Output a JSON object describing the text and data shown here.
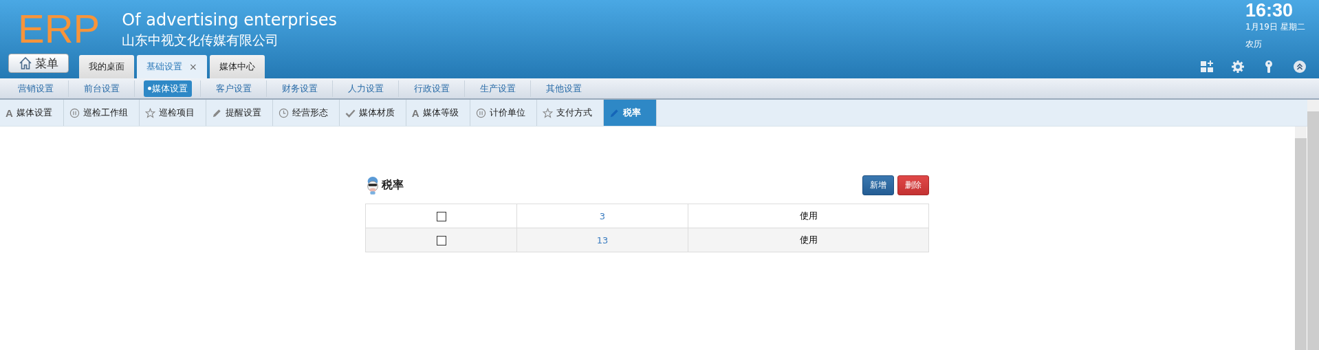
{
  "header": {
    "logo": "ERP",
    "title": "Of advertising enterprises",
    "subtitle": "山东中视文化传媒有限公司",
    "menu_button": "菜单",
    "clock": {
      "time": "16:30",
      "date": "1月19日 星期二",
      "lunar": "农历"
    }
  },
  "tabs": [
    {
      "label": "我的桌面",
      "selected": false
    },
    {
      "label": "基础设置",
      "selected": true,
      "close": "×"
    },
    {
      "label": "媒体中心",
      "selected": false
    }
  ],
  "subnav": [
    {
      "label": "营销设置",
      "selected": false
    },
    {
      "label": "前台设置",
      "selected": false
    },
    {
      "label": "媒体设置",
      "selected": true
    },
    {
      "label": "客户设置",
      "selected": false
    },
    {
      "label": "财务设置",
      "selected": false
    },
    {
      "label": "人力设置",
      "selected": false
    },
    {
      "label": "行政设置",
      "selected": false
    },
    {
      "label": "生产设置",
      "selected": false
    },
    {
      "label": "其他设置",
      "selected": false
    }
  ],
  "toolbar": [
    {
      "label": "媒体设置",
      "kind": "letter",
      "icon_text": "A",
      "selected": false
    },
    {
      "label": "巡检工作组",
      "kind": "pause",
      "selected": false
    },
    {
      "label": "巡检项目",
      "kind": "star",
      "selected": false
    },
    {
      "label": "提醒设置",
      "kind": "pencil",
      "selected": false
    },
    {
      "label": "经营形态",
      "kind": "clock",
      "selected": false
    },
    {
      "label": "媒体材质",
      "kind": "check",
      "selected": false
    },
    {
      "label": "媒体等级",
      "kind": "letter",
      "icon_text": "A",
      "selected": false
    },
    {
      "label": "计价单位",
      "kind": "pause",
      "selected": false
    },
    {
      "label": "支付方式",
      "kind": "star",
      "selected": false
    },
    {
      "label": "税率",
      "kind": "pencil",
      "selected": true
    }
  ],
  "panel": {
    "title": "税率",
    "buttons": [
      {
        "label": "新增",
        "kind": "primary"
      },
      {
        "label": "删除",
        "kind": "danger"
      }
    ],
    "rows": [
      {
        "checked": false,
        "rate": "3",
        "status": "使用"
      },
      {
        "checked": false,
        "rate": "13",
        "status": "使用"
      }
    ]
  }
}
